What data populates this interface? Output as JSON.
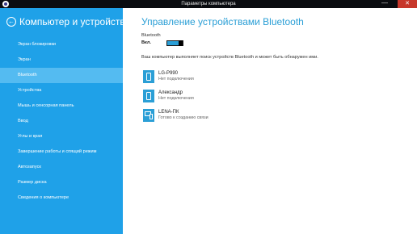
{
  "window": {
    "title": "Параметры компьютера",
    "minimize_glyph": "—",
    "close_glyph": "✕"
  },
  "sidebar": {
    "back_glyph": "←",
    "title": "Компьютер и устройства",
    "items": [
      {
        "label": "Экран блокировки",
        "active": false
      },
      {
        "label": "Экран",
        "active": false
      },
      {
        "label": "Bluetooth",
        "active": true
      },
      {
        "label": "Устройства",
        "active": false
      },
      {
        "label": "Мышь и сенсорная панель",
        "active": false
      },
      {
        "label": "Ввод",
        "active": false
      },
      {
        "label": "Углы и края",
        "active": false
      },
      {
        "label": "Завершение работы и спящий режим",
        "active": false
      },
      {
        "label": "Автозапуск",
        "active": false
      },
      {
        "label": "Размер диска",
        "active": false
      },
      {
        "label": "Сведения о компьютере",
        "active": false
      }
    ]
  },
  "main": {
    "title": "Управление устройствами Bluetooth",
    "bluetooth_label": "Bluetooth",
    "bluetooth_state": "Вкл.",
    "toggle_on": true,
    "scan_text": "Ваш компьютер выполняет поиск устройств Bluetooth и может быть обнаружен ими.",
    "devices": [
      {
        "name": "LG-P990",
        "status": "Нет подключения",
        "icon": "phone-icon"
      },
      {
        "name": "Александр",
        "status": "Нет подключения",
        "icon": "phone-icon"
      },
      {
        "name": "LENA-ПК",
        "status": "Готово к созданию связи",
        "icon": "computer-icon"
      }
    ]
  },
  "colors": {
    "accent": "#2b9fd6",
    "sidebar_bg": "#1fa1e8",
    "sidebar_active": "#54bbf1",
    "close_button": "#c7372b"
  }
}
